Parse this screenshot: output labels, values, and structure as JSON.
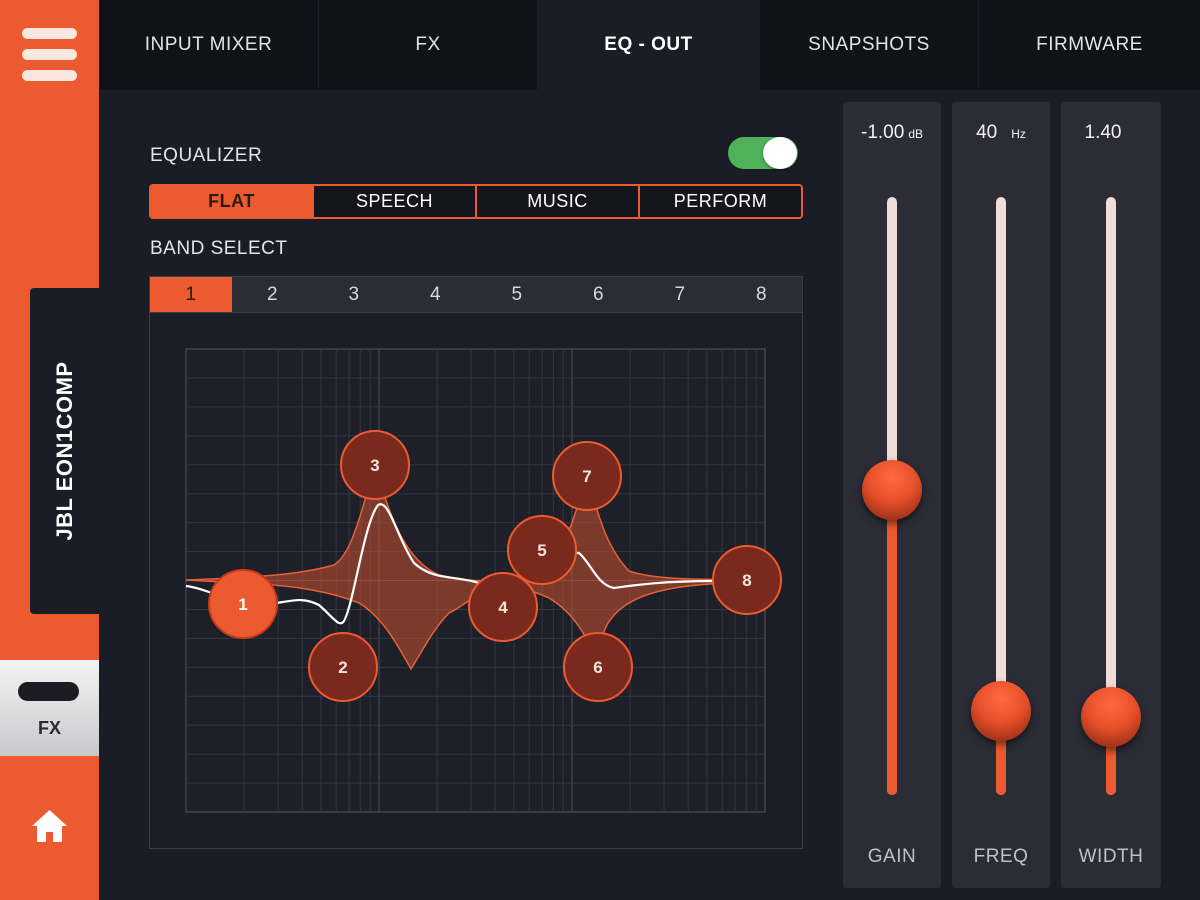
{
  "sidebar": {
    "device_name": "JBL EON1COMP",
    "fx_label": "FX"
  },
  "tabs": [
    {
      "label": "INPUT MIXER",
      "active": false
    },
    {
      "label": "FX",
      "active": false
    },
    {
      "label": "EQ - OUT",
      "active": true
    },
    {
      "label": "SNAPSHOTS",
      "active": false
    },
    {
      "label": "FIRMWARE",
      "active": false
    }
  ],
  "equalizer": {
    "title": "EQUALIZER",
    "enabled": true,
    "presets": [
      {
        "label": "FLAT",
        "active": true
      },
      {
        "label": "SPEECH",
        "active": false
      },
      {
        "label": "MUSIC",
        "active": false
      },
      {
        "label": "PERFORM",
        "active": false
      }
    ]
  },
  "band_select": {
    "title": "BAND SELECT",
    "bands": [
      "1",
      "2",
      "3",
      "4",
      "5",
      "6",
      "7",
      "8"
    ],
    "selected": "1"
  },
  "eq_nodes": [
    "1",
    "2",
    "3",
    "4",
    "5",
    "6",
    "7",
    "8"
  ],
  "sliders": {
    "gain": {
      "label": "GAIN",
      "value": "-1.00",
      "unit": "dB",
      "level": 0.51
    },
    "freq": {
      "label": "FREQ",
      "value": "40",
      "unit": "Hz",
      "level": 0.14
    },
    "width": {
      "label": "WIDTH",
      "value": "1.40",
      "unit": "",
      "level": 0.13
    }
  },
  "colors": {
    "accent": "#ee5a2f",
    "background": "#1b1d26",
    "toggle_on": "#4fb15a",
    "node_fill": "#7a2a1c"
  },
  "icons": {
    "menu": "hamburger-icon",
    "home": "home-icon"
  }
}
